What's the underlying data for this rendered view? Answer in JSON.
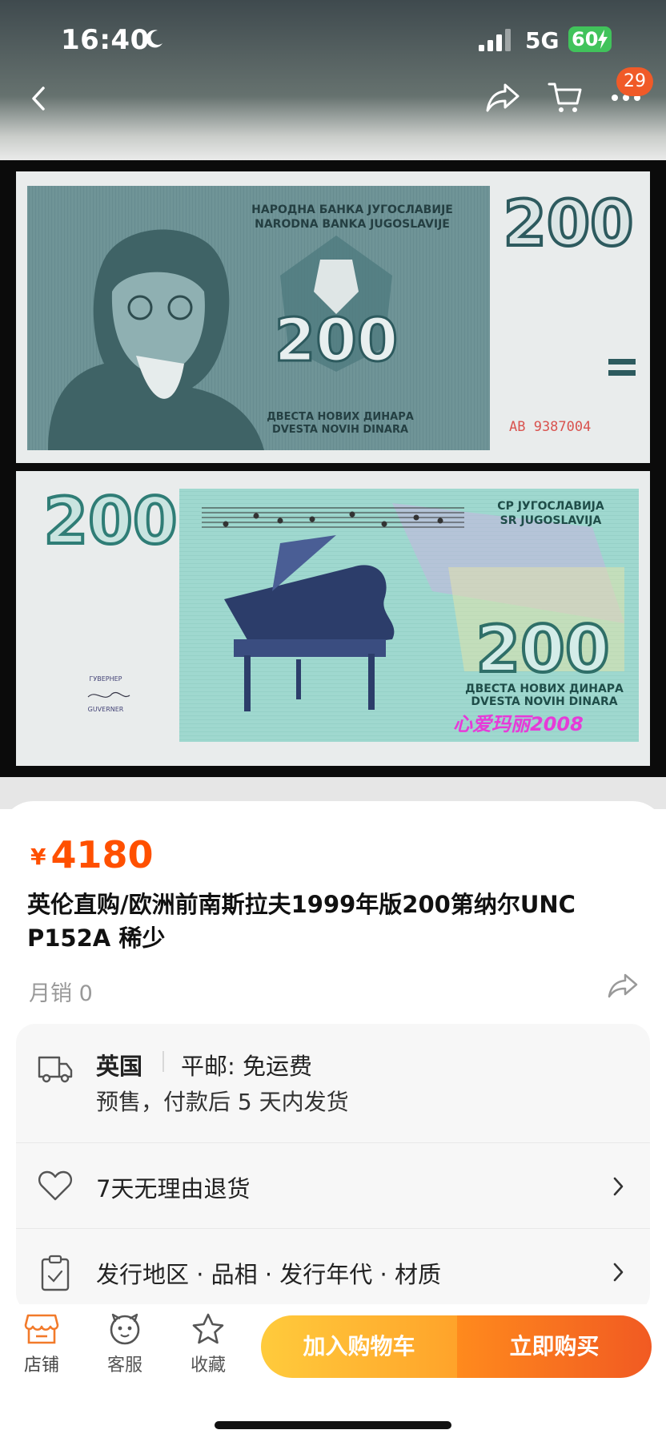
{
  "status_bar": {
    "time": "16:40",
    "network": "5G",
    "battery": "60"
  },
  "nav": {
    "cart_badge": "29"
  },
  "banknote": {
    "front_title_cyrillic": "НАРОДНА БАНКА ЈУГОСЛАВИЈЕ",
    "front_title_latin": "NARODNA BANKA JUGOSLAVIJE",
    "denomination": "200",
    "front_words_cyrillic": "ДВЕСТА НОВИХ ДИНАРА",
    "front_words_latin": "DVESTA NOVIH DINARA",
    "serial": "AB 9387004",
    "back_country_cyrillic": "СР ЈУГОСЛАВИЈА",
    "back_country_latin": "SR JUGOSLAVIJA",
    "back_words_cyrillic": "ДВЕСТА НОВИХ ДИНАРА",
    "back_words_latin": "DVESTA NOVIH DINARA",
    "governor_cyrillic": "ГУВЕРНЕР",
    "governor_latin": "GUVERNER",
    "watermark": "心爱玛丽2008"
  },
  "product": {
    "currency": "¥",
    "price": "4180",
    "title": "英伦直购/欧洲前南斯拉夫1999年版200第纳尔UNC P152A 稀少",
    "monthly_sales": "月销 0"
  },
  "info": {
    "origin": "英国",
    "shipping": "平邮: 免运费",
    "presale": "预售，付款后 5 天内发货",
    "returns": "7天无理由退货",
    "params": "发行地区 · 品相 · 发行年代 · 材质"
  },
  "bottom": {
    "shop": "店铺",
    "service": "客服",
    "favorite": "收藏",
    "add_cart": "加入购物车",
    "buy_now": "立即购买"
  },
  "colors": {
    "accent": "#ff5000",
    "cart_button": "#ffb32f",
    "buy_button": "#f4641f"
  },
  "icons": [
    "back-arrow-icon",
    "share-icon",
    "cart-icon",
    "more-icon",
    "truck-icon",
    "heart-icon",
    "clipboard-icon",
    "chevron-right-icon",
    "shop-icon",
    "service-icon",
    "star-icon"
  ]
}
